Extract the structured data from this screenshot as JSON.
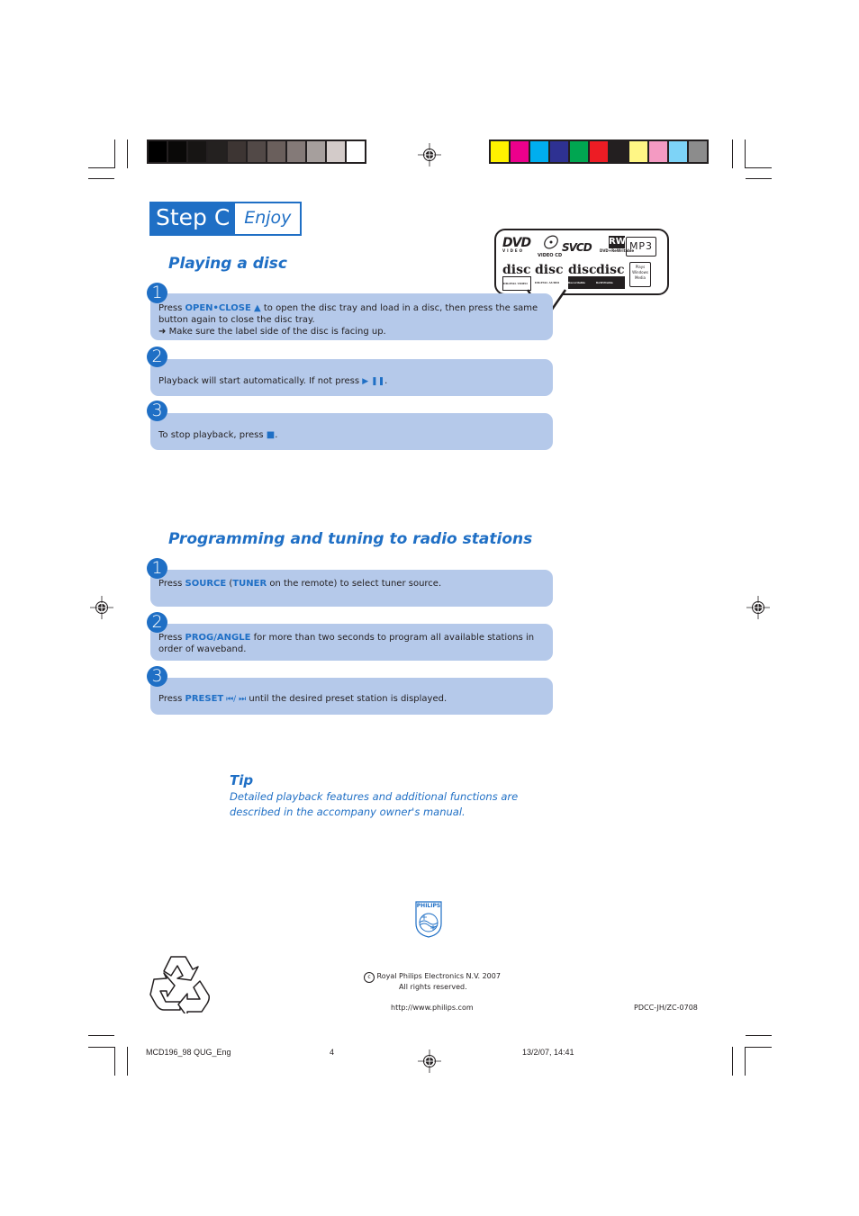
{
  "color_bars": {
    "grayscale": [
      "#000000",
      "#0a0908",
      "#171514",
      "#242120",
      "#3d3533",
      "#524947",
      "#6a5f5c",
      "#847a78",
      "#a69f9d",
      "#d3cbc9",
      "#ffffff"
    ],
    "process": [
      "#fff200",
      "#ec008c",
      "#00aeef",
      "#2e3192",
      "#00a651",
      "#ed1c24",
      "#231f20",
      "#fff685",
      "#f49ac2",
      "#7dd3f7",
      "#8c8c8c"
    ]
  },
  "header": {
    "step_label": "Step C",
    "step_subtitle": "Enjoy"
  },
  "disc_logos": {
    "top_row": [
      "DVD VIDEO",
      "VIDEO CD",
      "SVCD",
      "RW DVD+ReWritable",
      "MP3 (MP3-CD Playback)"
    ],
    "bottom_row": [
      "COMPACT disc DIGITAL VIDEO",
      "COMPACT disc DIGITAL AUDIO",
      "COMPACT disc Recordable",
      "COMPACT disc ReWritable",
      "Plays Windows Media"
    ]
  },
  "playing_disc": {
    "title": "Playing a disc",
    "steps": [
      {
        "number": "1",
        "pre": "Press ",
        "keyword": "OPEN•CLOSE",
        "icon": "▲",
        "post": " to open the disc tray and load in a disc, then press the same button again to close the disc tray.",
        "note_arrow": "➜",
        "note": " Make sure the label side of the disc is facing up."
      },
      {
        "number": "2",
        "pre": "Playback will start automatically. If not press ",
        "icon": "▶ ❚❚",
        "post": "."
      },
      {
        "number": "3",
        "pre": "To stop playback, press ",
        "icon": "■",
        "post": "."
      }
    ]
  },
  "radio": {
    "title": "Programming and tuning to radio stations",
    "steps": [
      {
        "number": "1",
        "pre": "Press ",
        "keyword": "SOURCE",
        "mid": " (",
        "keyword2": "TUNER",
        "post": " on the remote) to select tuner source."
      },
      {
        "number": "2",
        "pre": "Press ",
        "keyword": "PROG/ANGLE",
        "post": " for more than two seconds to program all available stations in order of waveband."
      },
      {
        "number": "3",
        "pre": "Press ",
        "keyword": "PRESET",
        "icon": " ⏮/ ⏭",
        "post": " until the desired preset station is displayed."
      }
    ]
  },
  "tip": {
    "title": "Tip",
    "body": "Detailed playback features and additional functions are described in the accompany owner's manual."
  },
  "brand": {
    "logo_text": "PHILIPS"
  },
  "footer": {
    "copyright_symbol": "c",
    "copyright": "Royal Philips Electronics N.V. 2007",
    "rights": "All rights reserved.",
    "url": "http://www.philips.com",
    "code": "PDCC-JH/ZC-0708"
  },
  "slug": {
    "file": "MCD196_98 QUG_Eng",
    "page": "4",
    "datetime": "13/2/07, 14:41"
  }
}
